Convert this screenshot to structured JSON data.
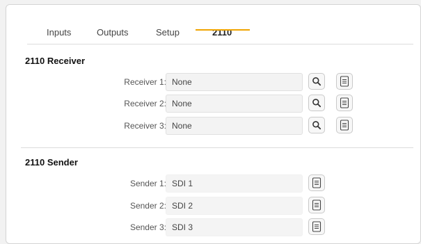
{
  "tabs": [
    {
      "label": "Inputs",
      "active": false
    },
    {
      "label": "Outputs",
      "active": false
    },
    {
      "label": "Setup",
      "active": false
    },
    {
      "label": "2110",
      "active": true
    }
  ],
  "accent_color": "#f0a400",
  "receiver": {
    "title": "2110 Receiver",
    "rows": [
      {
        "label": "Receiver 1:",
        "value": "None"
      },
      {
        "label": "Receiver 2:",
        "value": "None"
      },
      {
        "label": "Receiver 3:",
        "value": "None"
      }
    ],
    "icons": [
      "search-icon",
      "document-icon"
    ]
  },
  "sender": {
    "title": "2110 Sender",
    "rows": [
      {
        "label": "Sender 1:",
        "value": "SDI 1"
      },
      {
        "label": "Sender 2:",
        "value": "SDI 2"
      },
      {
        "label": "Sender 3:",
        "value": "SDI 3"
      }
    ],
    "icons": [
      "document-icon"
    ]
  }
}
